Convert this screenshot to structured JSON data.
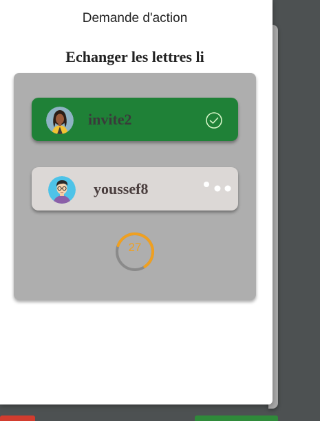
{
  "dialog": {
    "title": "Demande d'action",
    "action_title": "Echanger les lettres li"
  },
  "players": [
    {
      "name": "invite2",
      "status": "accepted",
      "status_icon": "check-circle-icon",
      "avatar": "female-avatar",
      "card_color": "#1f8137"
    },
    {
      "name": "youssef8",
      "status": "pending",
      "status_icon": "three-dots-icon",
      "avatar": "male-glasses-avatar",
      "card_color": "#dcd8d6"
    }
  ],
  "timer": {
    "value": "27",
    "progress_fraction": 0.6,
    "color": "#f0a020"
  },
  "colors": {
    "accepted": "#1f8137",
    "panel": "#aeaeae",
    "timer": "#f0a020"
  }
}
